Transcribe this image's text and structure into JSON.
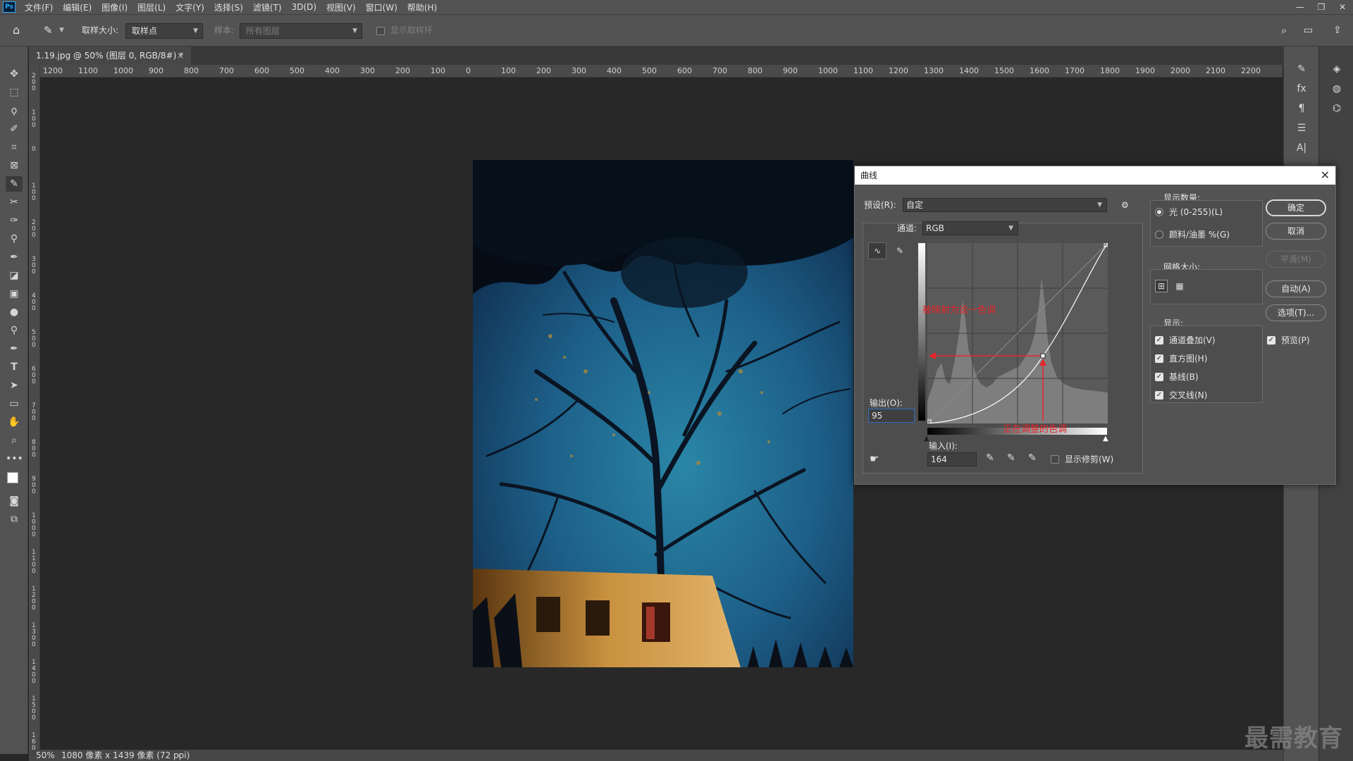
{
  "app": {
    "logo_text": "Ps"
  },
  "menubar": {
    "items": [
      "文件(F)",
      "编辑(E)",
      "图像(I)",
      "图层(L)",
      "文字(Y)",
      "选择(S)",
      "滤镜(T)",
      "3D(D)",
      "视图(V)",
      "窗口(W)",
      "帮助(H)"
    ]
  },
  "options": {
    "sample_size_label": "取样大小:",
    "sample_size_value": "取样点",
    "sample_label": "样本:",
    "sample_value": "所有图层",
    "show_ring_label": "显示取样环"
  },
  "document": {
    "tab_title": "1.19.jpg @ 50% (图层 0, RGB/8#) *",
    "zoom": "50%",
    "status_info": "1080 像素 x 1439 像素 (72 ppi)"
  },
  "rulers": {
    "h_ticks": [
      "1200",
      "1100",
      "1000",
      "900",
      "800",
      "700",
      "600",
      "500",
      "400",
      "300",
      "200",
      "100",
      "0",
      "100",
      "200",
      "300",
      "400",
      "500",
      "600",
      "700",
      "800",
      "900",
      "1000",
      "1100",
      "1200",
      "1300",
      "1400",
      "1500",
      "1600",
      "1700",
      "1800",
      "1900",
      "2000",
      "2100",
      "2200"
    ],
    "v_ticks": [
      "200",
      "100",
      "0",
      "100",
      "200",
      "300",
      "400",
      "500",
      "600",
      "700",
      "800",
      "900",
      "1000",
      "1100",
      "1200",
      "1300",
      "1400",
      "1500",
      "1600"
    ]
  },
  "curves": {
    "title": "曲线",
    "preset_label": "预设(R):",
    "preset_value": "自定",
    "channel_label": "通道:",
    "channel_value": "RGB",
    "output_label": "输出(O):",
    "output_value": "95",
    "input_label": "输入(I):",
    "input_value": "164",
    "show_clipping_label": "显示修剪(W)",
    "show_clipping_checked": false,
    "annotation_output": "被映射为这一色调",
    "annotation_input": "正在调整的色调",
    "point_input": 164,
    "point_output": 95,
    "display_amount_label": "显示数量:",
    "light_option": "光 (0-255)(L)",
    "pigment_option": "颜料/油墨 %(G)",
    "light_selected": true,
    "grid_size_label": "网格大小:",
    "show_label": "显示:",
    "show_options": [
      {
        "label": "通道叠加(V)",
        "checked": true
      },
      {
        "label": "直方图(H)",
        "checked": true
      },
      {
        "label": "基线(B)",
        "checked": true
      },
      {
        "label": "交叉线(N)",
        "checked": true
      }
    ],
    "buttons": {
      "ok": "确定",
      "cancel": "取消",
      "smooth": "平滑(M)",
      "auto": "自动(A)",
      "options": "选项(T)..."
    },
    "preview_label": "预览(P)",
    "preview_checked": true
  },
  "watermark": "最需教育",
  "colors": {
    "annotation_red": "#e8262b",
    "panel_bg": "#535353",
    "canvas_bg": "#282828"
  }
}
